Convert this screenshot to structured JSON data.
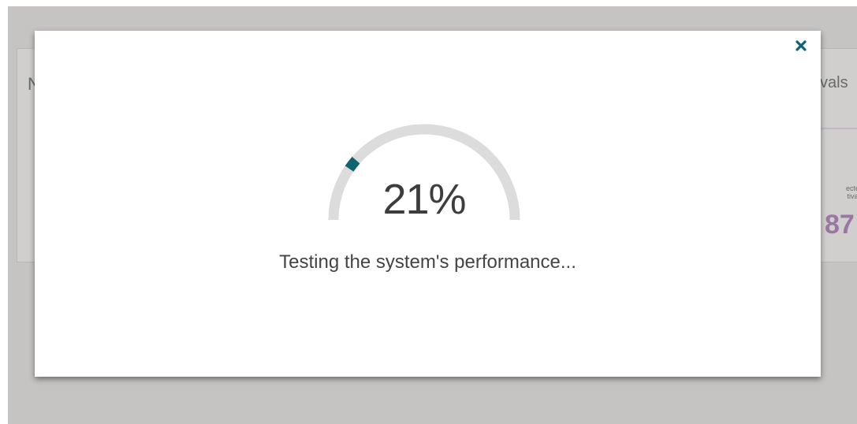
{
  "background": {
    "left_heading": "N",
    "right_heading": "vals",
    "stat_label_line1": "ected",
    "stat_label_line2": "tivals",
    "stat_value": "87"
  },
  "modal": {
    "close_icon": "close-icon",
    "progress_percent_label": "21%",
    "progress_value": 0.21,
    "status_text": "Testing the system's performance...",
    "accent_color": "#0f6470",
    "track_color": "#dcdcdc"
  }
}
